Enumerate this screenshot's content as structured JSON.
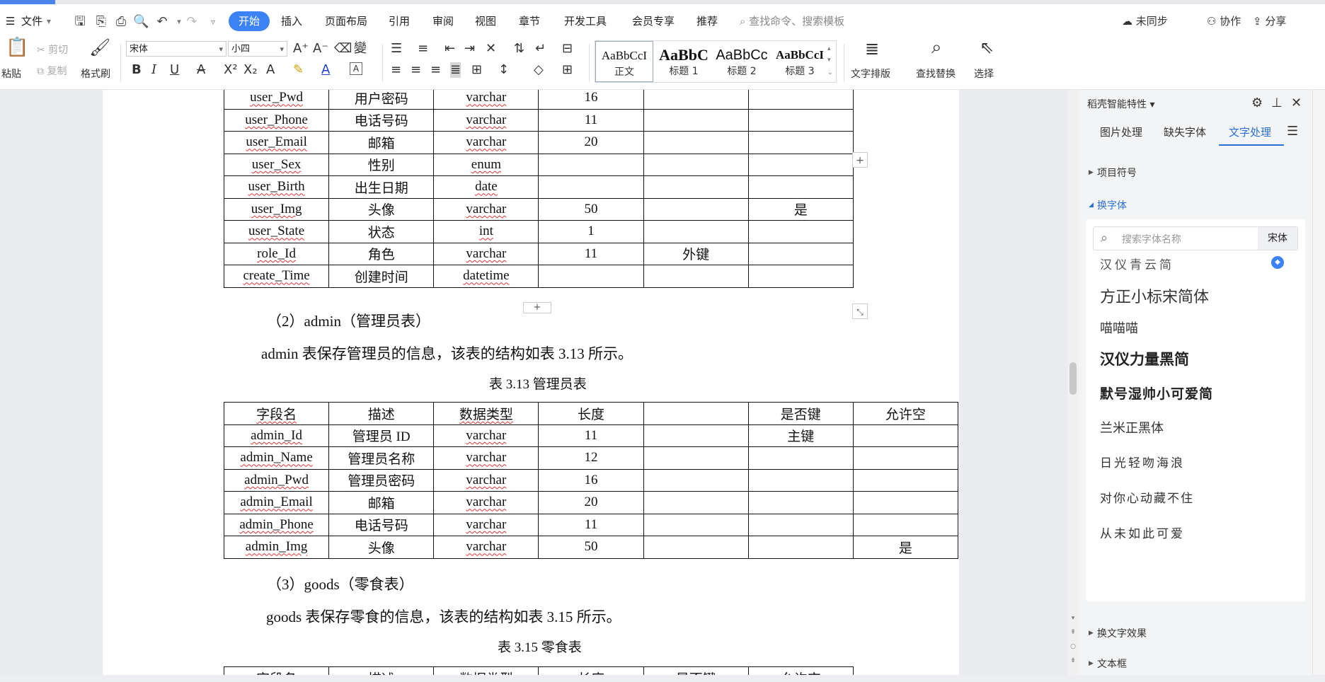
{
  "menubar": {
    "menu_icon": "hamburger-icon",
    "file_label": "文件",
    "tabs": [
      "开始",
      "插入",
      "页面布局",
      "引用",
      "审阅",
      "视图",
      "章节",
      "开发工具",
      "会员专享",
      "推荐"
    ],
    "active_tab": "开始",
    "search_placeholder": "查找命令、搜索模板",
    "sync_label": "未同步",
    "collab_label": "协作",
    "share_label": "分享"
  },
  "ribbon": {
    "paste": "粘贴",
    "cut": "剪切",
    "copy": "复制",
    "format_painter": "格式刷",
    "font_name": "宋体",
    "font_size": "小四",
    "styles": [
      {
        "sample": "AaBbCcI",
        "label": "正文"
      },
      {
        "sample": "AaBbC",
        "label": "标题 1"
      },
      {
        "sample": "AaBbCc",
        "label": "标题 2"
      },
      {
        "sample": "AaBbCcI",
        "label": "标题 3"
      }
    ],
    "text_layout": "文字排版",
    "find_replace": "查找替换",
    "select": "选择"
  },
  "document": {
    "table1_rows": [
      [
        "user_Pwd",
        "用户密码",
        "varchar",
        "16",
        "",
        ""
      ],
      [
        "user_Phone",
        "电话号码",
        "varchar",
        "11",
        "",
        ""
      ],
      [
        "user_Email",
        "邮箱",
        "varchar",
        "20",
        "",
        ""
      ],
      [
        "user_Sex",
        "性别",
        "enum",
        "",
        "",
        ""
      ],
      [
        "user_Birth",
        "出生日期",
        "date",
        "",
        "",
        ""
      ],
      [
        "user_Img",
        "头像",
        "varchar",
        "50",
        "",
        "是"
      ],
      [
        "user_State",
        "状态",
        "int",
        "1",
        "",
        ""
      ],
      [
        "role_Id",
        "角色",
        "varchar",
        "11",
        "外键",
        ""
      ],
      [
        "create_Time",
        "创建时间",
        "datetime",
        "",
        "",
        ""
      ]
    ],
    "heading2": "（2）admin（管理员表）",
    "para2": "admin 表保存管理员的信息，该表的结构如表 3.13 所示。",
    "caption2": "表 3.13  管理员表",
    "table2_header": [
      "字段名",
      "描述",
      "数据类型",
      "长度",
      "",
      "是否键",
      "允许空"
    ],
    "table2_rows": [
      [
        "admin_Id",
        "管理员 ID",
        "varchar",
        "11",
        "",
        "主键",
        ""
      ],
      [
        "admin_Name",
        "管理员名称",
        "varchar",
        "12",
        "",
        "",
        ""
      ],
      [
        "admin_Pwd",
        "管理员密码",
        "varchar",
        "16",
        "",
        "",
        ""
      ],
      [
        "admin_Email",
        "邮箱",
        "varchar",
        "20",
        "",
        "",
        ""
      ],
      [
        "admin_Phone",
        "电话号码",
        "varchar",
        "11",
        "",
        "",
        ""
      ],
      [
        "admin_Img",
        "头像",
        "varchar",
        "50",
        "",
        "",
        "是"
      ]
    ],
    "heading3": "（3）goods（零食表）",
    "para3": "goods 表保存零食的信息，该表的结构如表 3.15 所示。",
    "caption3": "表 3.15  零食表",
    "table3_header": [
      "字段名",
      "描述",
      "数据类型",
      "长度",
      "是否键",
      "允许空"
    ]
  },
  "panel": {
    "title": "稻壳智能特性",
    "tabs": [
      "图片处理",
      "缺失字体",
      "文字处理"
    ],
    "active_tab": "文字处理",
    "sections": {
      "bullets": "项目符号",
      "change_font": "换字体",
      "text_effect": "换文字效果",
      "textbox": "文本框"
    },
    "font_search_placeholder": "搜索字体名称",
    "current_font": "宋体",
    "fonts": [
      "汉仪青云简",
      "方正小标宋简体",
      "喵喵喵",
      "汉仪力量黑简",
      "默号湿帅小可爱简",
      "兰米正黑体",
      "日光轻吻海浪",
      "对你心动藏不住",
      "从未如此可爱"
    ]
  }
}
